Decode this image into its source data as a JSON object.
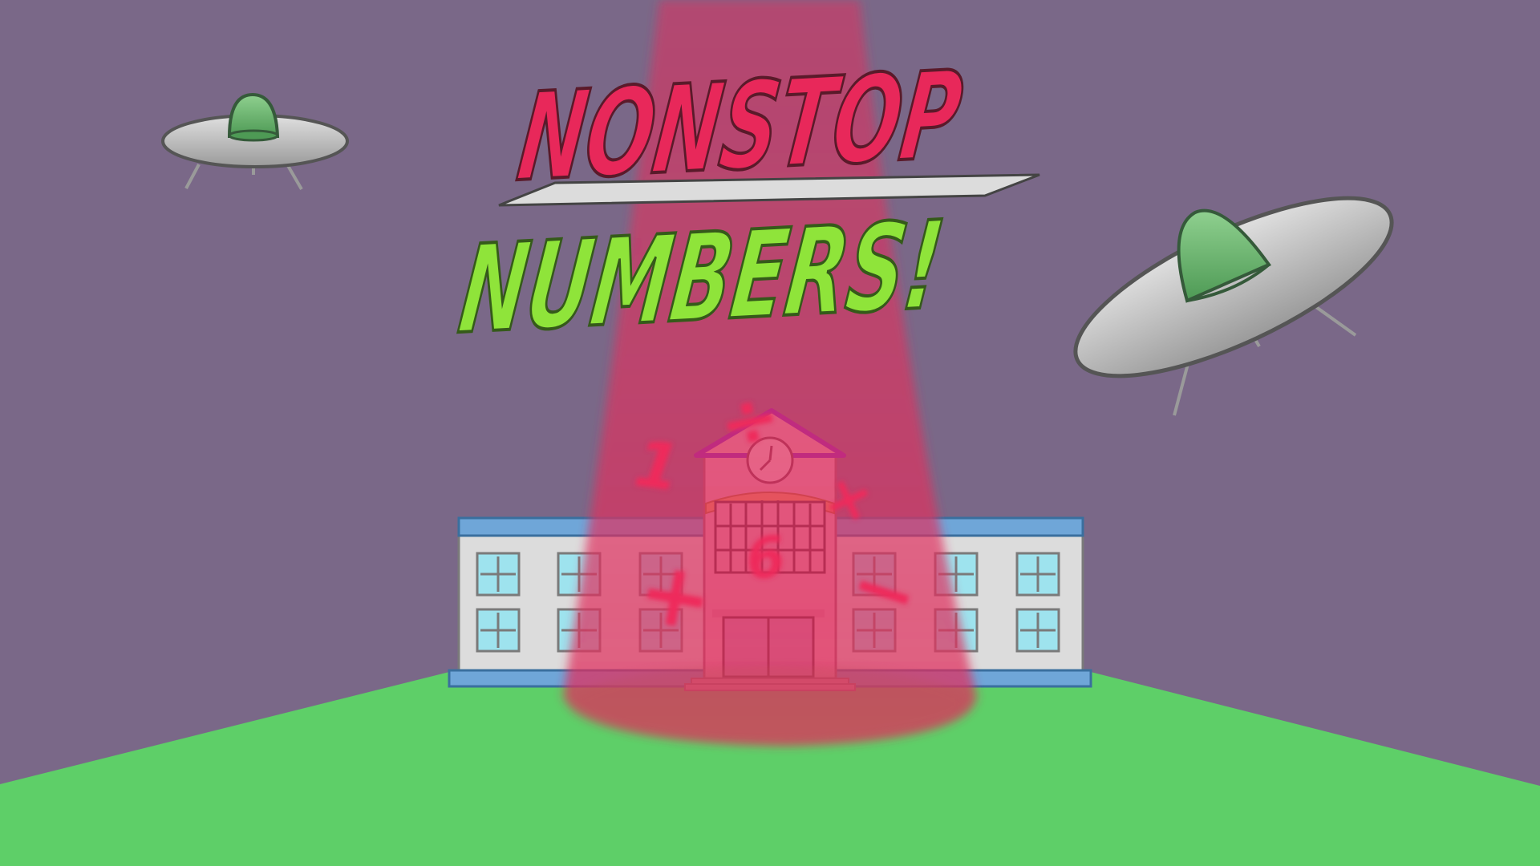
{
  "screen": "title-screen",
  "title": {
    "line1": "NONSTOP",
    "line2": "NUMBERS!"
  },
  "colors": {
    "sky": "#7a6888",
    "ground": "#5ecf68",
    "beam": "#e0305e",
    "title_red": "#e8285a",
    "title_green": "#8fe43a",
    "banner": "#dcdcdc",
    "roof_purple": "#8020c0"
  },
  "floating_symbols": [
    "1",
    "÷",
    "+",
    "6",
    "−",
    "×"
  ],
  "icons": [
    "ufo-small-icon",
    "ufo-large-icon",
    "school-building-icon",
    "clock-icon"
  ]
}
